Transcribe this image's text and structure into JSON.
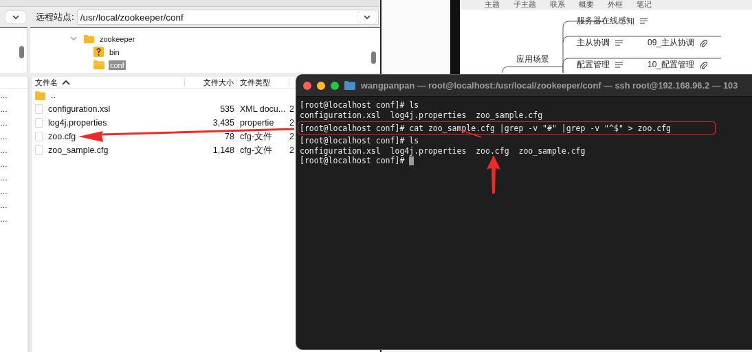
{
  "filezilla": {
    "local_panel": {
      "rows": [
        "…",
        "…",
        "…",
        "…",
        "…",
        "…",
        "…",
        "…",
        "…",
        "…"
      ]
    },
    "remote_site": {
      "label": "远程站点:",
      "path": "/usr/local/zookeeper/conf"
    },
    "remote_tree": [
      {
        "name": "zookeeper",
        "kind": "folder",
        "expanded": true,
        "selected": false,
        "children": [
          {
            "name": "bin",
            "kind": "unknown",
            "selected": false
          },
          {
            "name": "conf",
            "kind": "folder",
            "selected": true
          }
        ]
      }
    ],
    "file_list": {
      "columns": [
        {
          "label": "文件名",
          "sort_ascending": true
        },
        {
          "label": "文件大小"
        },
        {
          "label": "文件类型"
        }
      ],
      "rows": [
        {
          "name": "..",
          "kind": "parent"
        },
        {
          "name": "configuration.xsl",
          "kind": "file",
          "size": "535",
          "type": "XML docu...",
          "column_4": "2"
        },
        {
          "name": "log4j.properties",
          "kind": "file",
          "size": "3,435",
          "type": "propertie",
          "column_4": "2"
        },
        {
          "name": "zoo.cfg",
          "kind": "file",
          "size": "78",
          "type": "cfg-文件",
          "column_4": "2"
        },
        {
          "name": "zoo_sample.cfg",
          "kind": "file",
          "size": "1,148",
          "type": "cfg-文件",
          "column_4": "2"
        }
      ]
    }
  },
  "mind_map": {
    "toolbar": [
      "主题",
      "子主题",
      "联系",
      "概要",
      "外框",
      "笔记"
    ],
    "root": {
      "text": "应用场景",
      "children": [
        {
          "text": "服务器在线感知",
          "note": true
        },
        {
          "text": "主从协调",
          "note": true,
          "link": "09_主从协调"
        },
        {
          "text": "配置管理",
          "note": true,
          "link": "10_配置管理"
        }
      ]
    }
  },
  "terminal": {
    "title": "wangpanpan — root@localhost:/usr/local/zookeeper/conf — ssh root@192.168.96.2 — 103",
    "lines": [
      "[root@localhost conf]# ls",
      "configuration.xsl  log4j.properties  zoo_sample.cfg",
      "[root@localhost conf]# cat zoo_sample.cfg |grep -v \"#\" |grep -v \"^$\" > zoo.cfg",
      "[root@localhost conf]# ls",
      "configuration.xsl  log4j.properties  zoo.cfg  zoo_sample.cfg",
      "[root@localhost conf]# "
    ],
    "cursor": true
  }
}
